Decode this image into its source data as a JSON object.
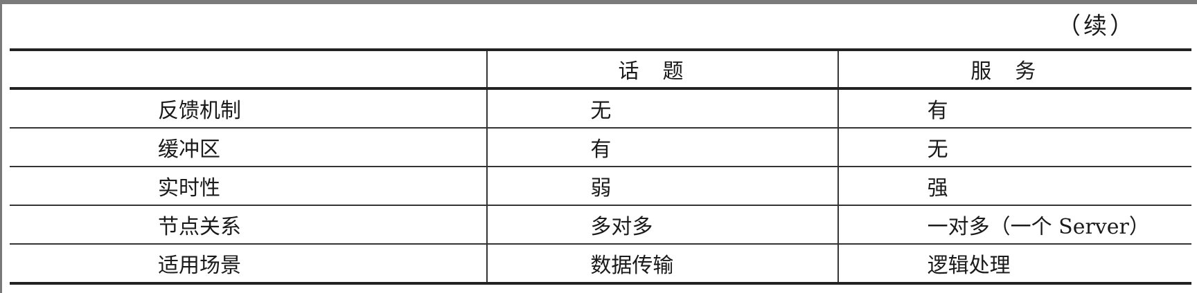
{
  "continued_label": "（续）",
  "table": {
    "headers": [
      "",
      "话题",
      "服务"
    ],
    "rows": [
      [
        "反馈机制",
        "无",
        "有"
      ],
      [
        "缓冲区",
        "有",
        "无"
      ],
      [
        "实时性",
        "弱",
        "强"
      ],
      [
        "节点关系",
        "多对多",
        "一对多（一个 Server）"
      ],
      [
        "适用场景",
        "数据传输",
        "逻辑处理"
      ]
    ]
  }
}
